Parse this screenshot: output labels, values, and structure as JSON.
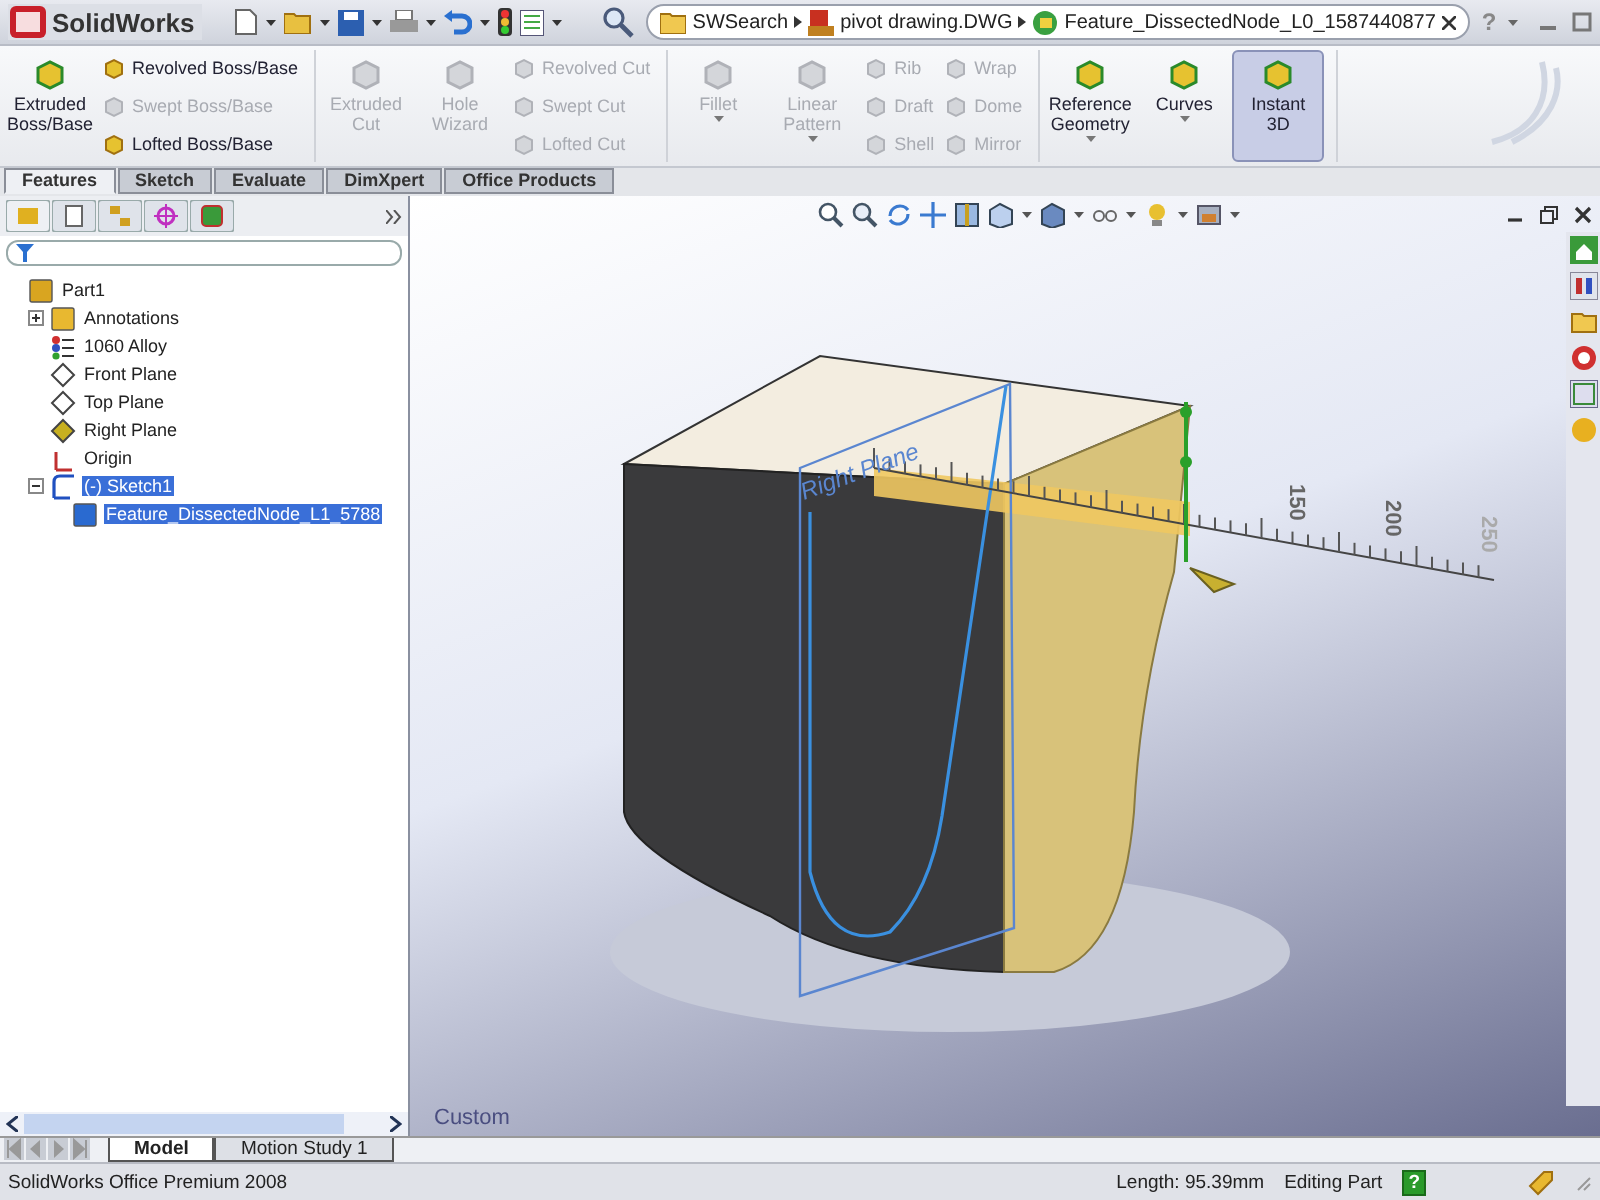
{
  "app": {
    "name": "SolidWorks"
  },
  "search": {
    "scope": "SWSearch",
    "breadcrumb": [
      "pivot drawing.DWG",
      "Feature_DissectedNode_L0_1587440877"
    ],
    "help": "?"
  },
  "ribbon": [
    {
      "columns": [
        {
          "kind": "large",
          "label": "Extruded Boss/Base",
          "disabled": false,
          "selected": false,
          "dropdown": false
        },
        {
          "kind": "stack",
          "items": [
            {
              "label": "Revolved Boss/Base",
              "disabled": false
            },
            {
              "label": "Swept Boss/Base",
              "disabled": true
            },
            {
              "label": "Lofted Boss/Base",
              "disabled": false
            }
          ]
        }
      ]
    },
    {
      "columns": [
        {
          "kind": "large",
          "label": "Extruded Cut",
          "disabled": true,
          "selected": false,
          "dropdown": false
        },
        {
          "kind": "large",
          "label": "Hole Wizard",
          "disabled": true,
          "selected": false,
          "dropdown": false
        },
        {
          "kind": "stack",
          "items": [
            {
              "label": "Revolved Cut",
              "disabled": true
            },
            {
              "label": "Swept Cut",
              "disabled": true
            },
            {
              "label": "Lofted Cut",
              "disabled": true
            }
          ]
        }
      ]
    },
    {
      "columns": [
        {
          "kind": "large",
          "label": "Fillet",
          "disabled": true,
          "selected": false,
          "dropdown": true
        },
        {
          "kind": "large",
          "label": "Linear Pattern",
          "disabled": true,
          "selected": false,
          "dropdown": true
        },
        {
          "kind": "stack",
          "items": [
            {
              "label": "Rib",
              "disabled": true
            },
            {
              "label": "Draft",
              "disabled": true
            },
            {
              "label": "Shell",
              "disabled": true
            }
          ]
        },
        {
          "kind": "stack",
          "items": [
            {
              "label": "Wrap",
              "disabled": true
            },
            {
              "label": "Dome",
              "disabled": true
            },
            {
              "label": "Mirror",
              "disabled": true
            }
          ]
        }
      ]
    },
    {
      "columns": [
        {
          "kind": "large",
          "label": "Reference Geometry",
          "disabled": false,
          "selected": false,
          "dropdown": true
        },
        {
          "kind": "large",
          "label": "Curves",
          "disabled": false,
          "selected": false,
          "dropdown": true
        },
        {
          "kind": "large",
          "label": "Instant 3D",
          "disabled": false,
          "selected": true,
          "dropdown": false
        }
      ]
    }
  ],
  "command_tabs": [
    {
      "label": "Features",
      "selected": true
    },
    {
      "label": "Sketch",
      "selected": false
    },
    {
      "label": "Evaluate",
      "selected": false
    },
    {
      "label": "DimXpert",
      "selected": false
    },
    {
      "label": "Office Products",
      "selected": false
    }
  ],
  "feature_tree": [
    {
      "label": "Part1",
      "kind": "part",
      "selected": false,
      "children": [
        {
          "label": "Annotations",
          "kind": "annotations",
          "selected": false,
          "expanded": false
        },
        {
          "label": "1060 Alloy",
          "kind": "material",
          "selected": false
        },
        {
          "label": "Front Plane",
          "kind": "plane",
          "selected": false
        },
        {
          "label": "Top Plane",
          "kind": "plane",
          "selected": false
        },
        {
          "label": "Right Plane",
          "kind": "plane-active",
          "selected": false
        },
        {
          "label": "Origin",
          "kind": "origin",
          "selected": false
        },
        {
          "label": "(-) Sketch1",
          "kind": "sketch",
          "selected": true,
          "expanded": true,
          "children": [
            {
              "label": "Feature_DissectedNode_L1_5788",
              "kind": "feature",
              "selected": true
            }
          ]
        }
      ]
    }
  ],
  "viewport": {
    "plane_label": "Right Plane",
    "ruler_labels": [
      "150",
      "200",
      "250"
    ],
    "view_name": "Custom"
  },
  "document_tabs": [
    {
      "label": "Model",
      "selected": true
    },
    {
      "label": "Motion Study 1",
      "selected": false
    }
  ],
  "status_bar": {
    "product": "SolidWorks Office Premium 2008",
    "measurement": "Length: 95.39mm",
    "mode": "Editing Part",
    "help": "?"
  }
}
